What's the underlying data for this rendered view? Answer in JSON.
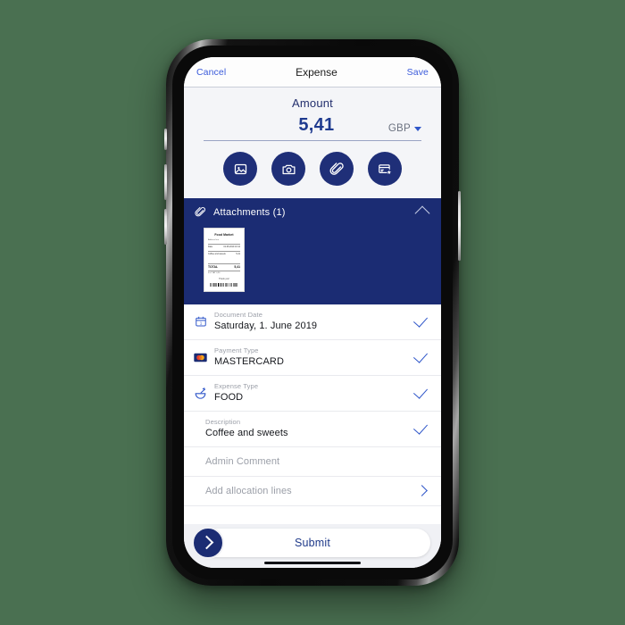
{
  "theme": {
    "page_background": "#4a7051",
    "brand_navy": "#1b2c73",
    "accent_blue": "#2f56c9",
    "panel_gray": "#f4f5f8"
  },
  "navbar": {
    "cancel_label": "Cancel",
    "title": "Expense",
    "save_label": "Save"
  },
  "amount": {
    "label": "Amount",
    "value": "5,41",
    "currency": "GBP",
    "currency_caret_icon": "caret-down-icon"
  },
  "actions": [
    {
      "name": "gallery-button",
      "icon": "image-gallery-icon"
    },
    {
      "name": "camera-button",
      "icon": "camera-icon"
    },
    {
      "name": "attach-file-button",
      "icon": "paperclip-icon"
    },
    {
      "name": "card-scan-button",
      "icon": "card-star-icon"
    }
  ],
  "attachments": {
    "icon": "paperclip-icon",
    "title": "Attachments (1)",
    "collapse_icon": "chevron-up-icon",
    "receipt": {
      "store": "Food Market",
      "address": "Address line",
      "meta_left": "Date",
      "meta_right": "01.06.2019 10:12",
      "item_name": "Coffee and sweets",
      "item_price": "5,41",
      "total_label": "TOTAL",
      "total_value": "5,41",
      "tax_note": "Incl. VAT 0,90",
      "thanks": "Thank you!",
      "barcode": "barcode"
    }
  },
  "fields": [
    {
      "name": "row-document-date",
      "icon": "calendar-icon",
      "label": "Document Date",
      "value": "Saturday, 1. June 2019",
      "status_icon": "check-icon",
      "has_value": true
    },
    {
      "name": "row-payment-type",
      "icon": "mastercard-icon",
      "label": "Payment Type",
      "value": "MASTERCARD",
      "status_icon": "check-icon",
      "has_value": true
    },
    {
      "name": "row-expense-type",
      "icon": "food-bowl-icon",
      "label": "Expense Type",
      "value": "FOOD",
      "status_icon": "check-icon",
      "has_value": true
    },
    {
      "name": "row-description",
      "icon": "",
      "label": "Description",
      "value": "Coffee and sweets",
      "status_icon": "check-icon",
      "has_value": true
    },
    {
      "name": "row-admin-comment",
      "icon": "",
      "label": "",
      "value": "Admin Comment",
      "status_icon": "",
      "has_value": false
    },
    {
      "name": "row-add-allocation-lines",
      "icon": "",
      "label": "",
      "value": "Add allocation lines",
      "status_icon": "chevron-right-icon",
      "has_value": false
    }
  ],
  "submit": {
    "label": "Submit",
    "icon": "chevron-right-circle-icon"
  }
}
